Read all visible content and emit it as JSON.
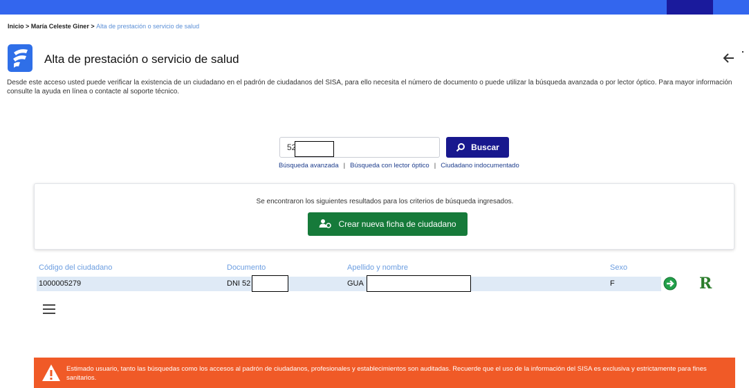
{
  "breadcrumb": {
    "home": "Inicio",
    "sep1": " > ",
    "user": "María Celeste Giner",
    "sep2": " > ",
    "current": "Alta de prestación o servicio de salud"
  },
  "page": {
    "title": "Alta de prestación o servicio de salud",
    "description": "Desde este acceso usted puede verificar la existencia de un ciudadano en el padrón de ciudadanos del SISA, para ello necesita el número de documento o puede utilizar la búsqueda avanzada o por lector óptico. Para mayor información consulte la ayuda en línea o contacte al soporte técnico."
  },
  "search": {
    "value": "52",
    "button_label": "Buscar",
    "links": [
      "Búsqueda avanzada",
      "Búsqueda con lector óptico",
      "Ciudadano indocumentado"
    ],
    "separator": "|"
  },
  "results": {
    "message": "Se encontraron los siguientes resultados para los criterios de búsqueda ingresados.",
    "create_button_label": "Crear nueva ficha de ciudadano",
    "columns": {
      "code": "Código del ciudadano",
      "document": "Documento",
      "name": "Apellido y nombre",
      "sex": "Sexo"
    },
    "rows": [
      {
        "code": "1000005279",
        "document": "DNI 52",
        "name": "GUA",
        "sex": "F"
      }
    ]
  },
  "actions": {
    "r_label": "R"
  },
  "alert": {
    "text": "Estimado usuario, tanto las búsquedas como los accesos al padrón de ciudadanos, profesionales y establecimientos son auditadas. Recuerde que el uso de la información del SISA es exclusiva y estrictamente para fines sanitarios."
  },
  "colors": {
    "topbar": "#3366ee",
    "primary_button": "#18188e",
    "success_button": "#167a3a",
    "alert": "#f05a27",
    "column_header": "#6b9de0",
    "row_highlight": "#dfeaf6"
  },
  "icons": [
    "app-logo-icon",
    "back-arrow-icon",
    "search-icon",
    "user-add-icon",
    "go-arrow-icon",
    "r-badge-icon",
    "menu-icon",
    "warning-icon"
  ]
}
